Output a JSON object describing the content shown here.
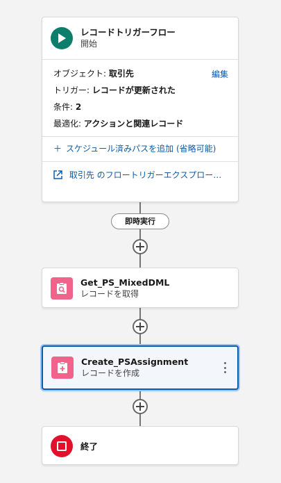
{
  "start_node": {
    "title": "レコードトリガーフロー",
    "subtitle": "開始",
    "edit_label": "編集",
    "rows": [
      {
        "label": "オブジェクト:",
        "value": "取引先"
      },
      {
        "label": "トリガー:",
        "value": "レコードが更新された"
      },
      {
        "label": "条件:",
        "value": "2"
      },
      {
        "label": "最適化:",
        "value": "アクションと関連レコード"
      }
    ],
    "add_path_label": "スケジュール済みパスを追加 (省略可能)",
    "explore_label": "取引先 のフロートリガーエクスプローラー"
  },
  "path_label": "即時実行",
  "nodes": [
    {
      "title": "Get_PS_MixedDML",
      "subtitle": "レコードを取得"
    },
    {
      "title": "Create_PSAssignment",
      "subtitle": "レコードを作成"
    },
    {
      "title": "終了"
    }
  ],
  "colors": {
    "start_icon": "#0d7d6c",
    "record_icon": "#f0638b",
    "end_icon": "#e3102c",
    "link": "#0b5cab",
    "selected_border": "#0b5cab"
  }
}
